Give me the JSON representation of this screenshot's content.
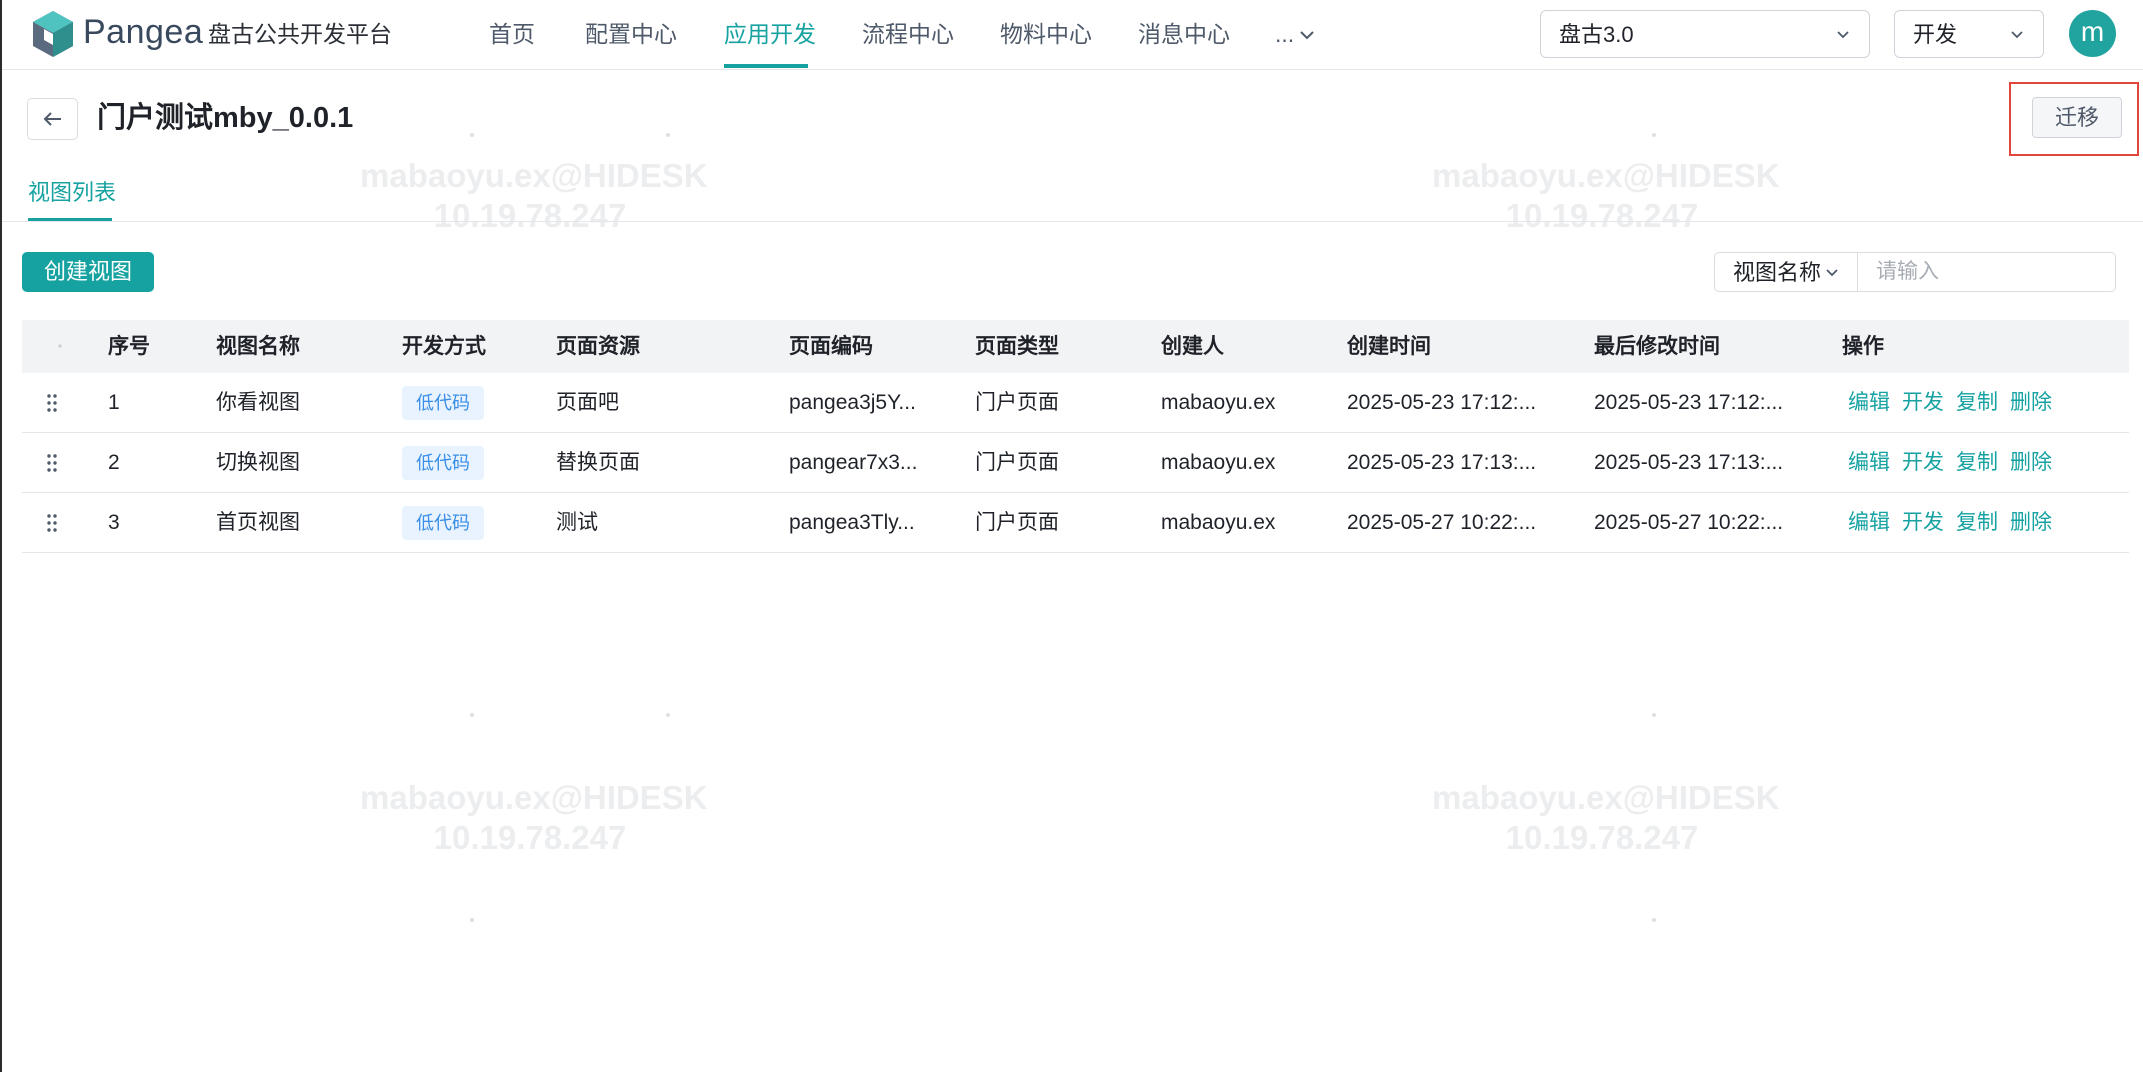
{
  "app": {
    "brand": "Pangea",
    "subtitle": "盘古公共开发平台"
  },
  "nav": {
    "items": [
      {
        "label": "首页",
        "active": false
      },
      {
        "label": "配置中心",
        "active": false
      },
      {
        "label": "应用开发",
        "active": true
      },
      {
        "label": "流程中心",
        "active": false
      },
      {
        "label": "物料中心",
        "active": false
      },
      {
        "label": "消息中心",
        "active": false
      },
      {
        "label": "...",
        "active": false
      }
    ],
    "more_icon": "chevron-down-icon"
  },
  "env_select": {
    "value": "盘古3.0"
  },
  "mode_select": {
    "value": "开发"
  },
  "user": {
    "avatar_letter": "m"
  },
  "page": {
    "title": "门户测试mby_0.0.1",
    "back_icon": "arrow-left-icon",
    "migrate_label": "迁移"
  },
  "tabs": [
    {
      "label": "视图列表",
      "active": true
    }
  ],
  "toolbar": {
    "create_label": "创建视图",
    "filter_field": "视图名称",
    "filter_placeholder": "请输入"
  },
  "table": {
    "columns": [
      "序号",
      "视图名称",
      "开发方式",
      "页面资源",
      "页面编码",
      "页面类型",
      "创建人",
      "创建时间",
      "最后修改时间",
      "操作"
    ],
    "rows": [
      {
        "index": "1",
        "name": "你看视图",
        "dev_mode": "低代码",
        "resource": "页面吧",
        "code": "pangea3j5Y...",
        "type": "门户页面",
        "creator": "mabaoyu.ex",
        "created": "2025-05-23 17:12:...",
        "modified": "2025-05-23 17:12:..."
      },
      {
        "index": "2",
        "name": "切换视图",
        "dev_mode": "低代码",
        "resource": "替换页面",
        "code": "pangear7x3...",
        "type": "门户页面",
        "creator": "mabaoyu.ex",
        "created": "2025-05-23 17:13:...",
        "modified": "2025-05-23 17:13:..."
      },
      {
        "index": "3",
        "name": "首页视图",
        "dev_mode": "低代码",
        "resource": "测试",
        "code": "pangea3Tly...",
        "type": "门户页面",
        "creator": "mabaoyu.ex",
        "created": "2025-05-27 10:22:...",
        "modified": "2025-05-27 10:22:..."
      }
    ],
    "actions": [
      "编辑",
      "开发",
      "复制",
      "删除"
    ]
  },
  "watermark": {
    "line1": "mabaoyu.ex@HIDESK",
    "line2": "10.19.78.247"
  },
  "colors": {
    "accent": "#17a2a2",
    "tag_bg": "#e8f3ff",
    "tag_text": "#3a8ee6",
    "highlight": "#e0463a"
  }
}
